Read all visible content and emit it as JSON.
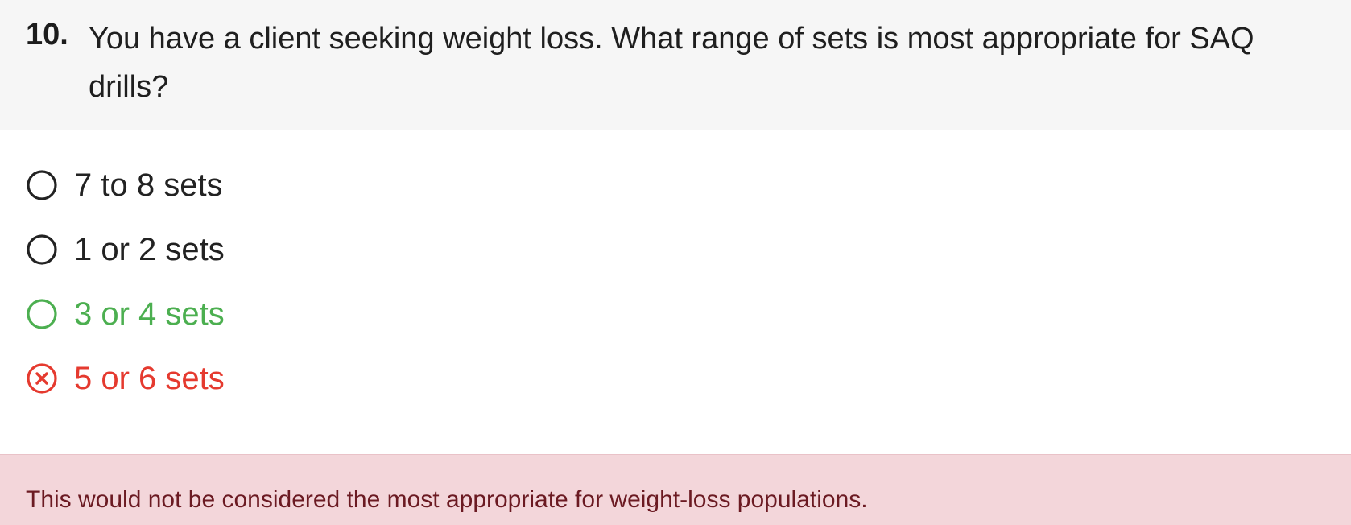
{
  "question": {
    "number": "10.",
    "text": "You have a client seeking weight loss. What range of sets is most appropriate for SAQ drills?"
  },
  "options": [
    {
      "label": "7 to 8 sets",
      "state": "default",
      "icon": "radio-empty-icon"
    },
    {
      "label": "1 or 2 sets",
      "state": "default",
      "icon": "radio-empty-icon"
    },
    {
      "label": "3 or 4 sets",
      "state": "correct",
      "icon": "radio-correct-icon"
    },
    {
      "label": "5 or 6 sets",
      "state": "incorrect-selected",
      "icon": "radio-x-icon"
    }
  ],
  "feedback": {
    "text": "This would not be considered the most appropriate for weight-loss populations."
  },
  "colors": {
    "header_bg": "#f6f6f6",
    "default_text": "#222222",
    "correct": "#4caf50",
    "incorrect": "#e53a2f",
    "feedback_bg": "#f3d6da",
    "feedback_text": "#6b1a22"
  }
}
